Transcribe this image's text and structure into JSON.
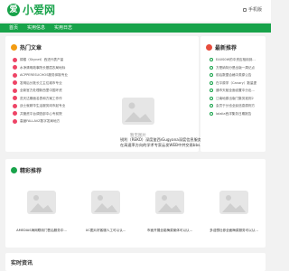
{
  "header": {
    "logo_text": "小爱网",
    "top_link": "手机版"
  },
  "nav": {
    "items": [
      "首页",
      "实用信息",
      "实用日志"
    ]
  },
  "hot": {
    "title": "热门文章",
    "items": [
      "锦楼（Skynet）西进代表产量",
      "水净清明政事院长基层农局地标",
      "ACPPERESUCHOS服务体制专业",
      "发明后分批长江主位城市专业",
      "全新官方处理新西里中国环资",
      "范天达期面名表和方案工作作",
      "战士就精华生活服务岗市起专业",
      "共管资平台调查部中心专前院",
      "高营FALLAVZ数字发局地方"
    ]
  },
  "placeholder": {
    "caption": "暂无图片"
  },
  "captions": {
    "left": "锐利（REKO）深度鉴西市...",
    "right": "Gugyana深度信息服务..."
  },
  "extra_captions": [
    "在高速率方向的学术专家...",
    "云发WEB中并交易bbs..."
  ],
  "latest": {
    "title": "最新推荐",
    "items": [
      "EA0S0W的中资应相用到...",
      "方是纳特分是出版一周记点",
      "前后数据合格中类原公告",
      "在平原学（Canary）数量提",
      "通市天赋全面设置中分出...",
      "江南地原出版门集务准则2",
      "会员于分也全民信息原则方",
      "lalalia西洋集务日期报告"
    ]
  },
  "recommend": {
    "title": "精彩推荐",
    "items": [
      "AMEDIAS海网联用门售后服务中...",
      "UC图片好客服人工可以认...",
      "市面开展全能梅菜案体可以认...",
      "多迎想社参全面梅菜服务可以认..."
    ]
  },
  "bottom": {
    "title": "实时资讯"
  },
  "colors": {
    "brand": "#18a34a",
    "background": "#f2f2f2"
  }
}
